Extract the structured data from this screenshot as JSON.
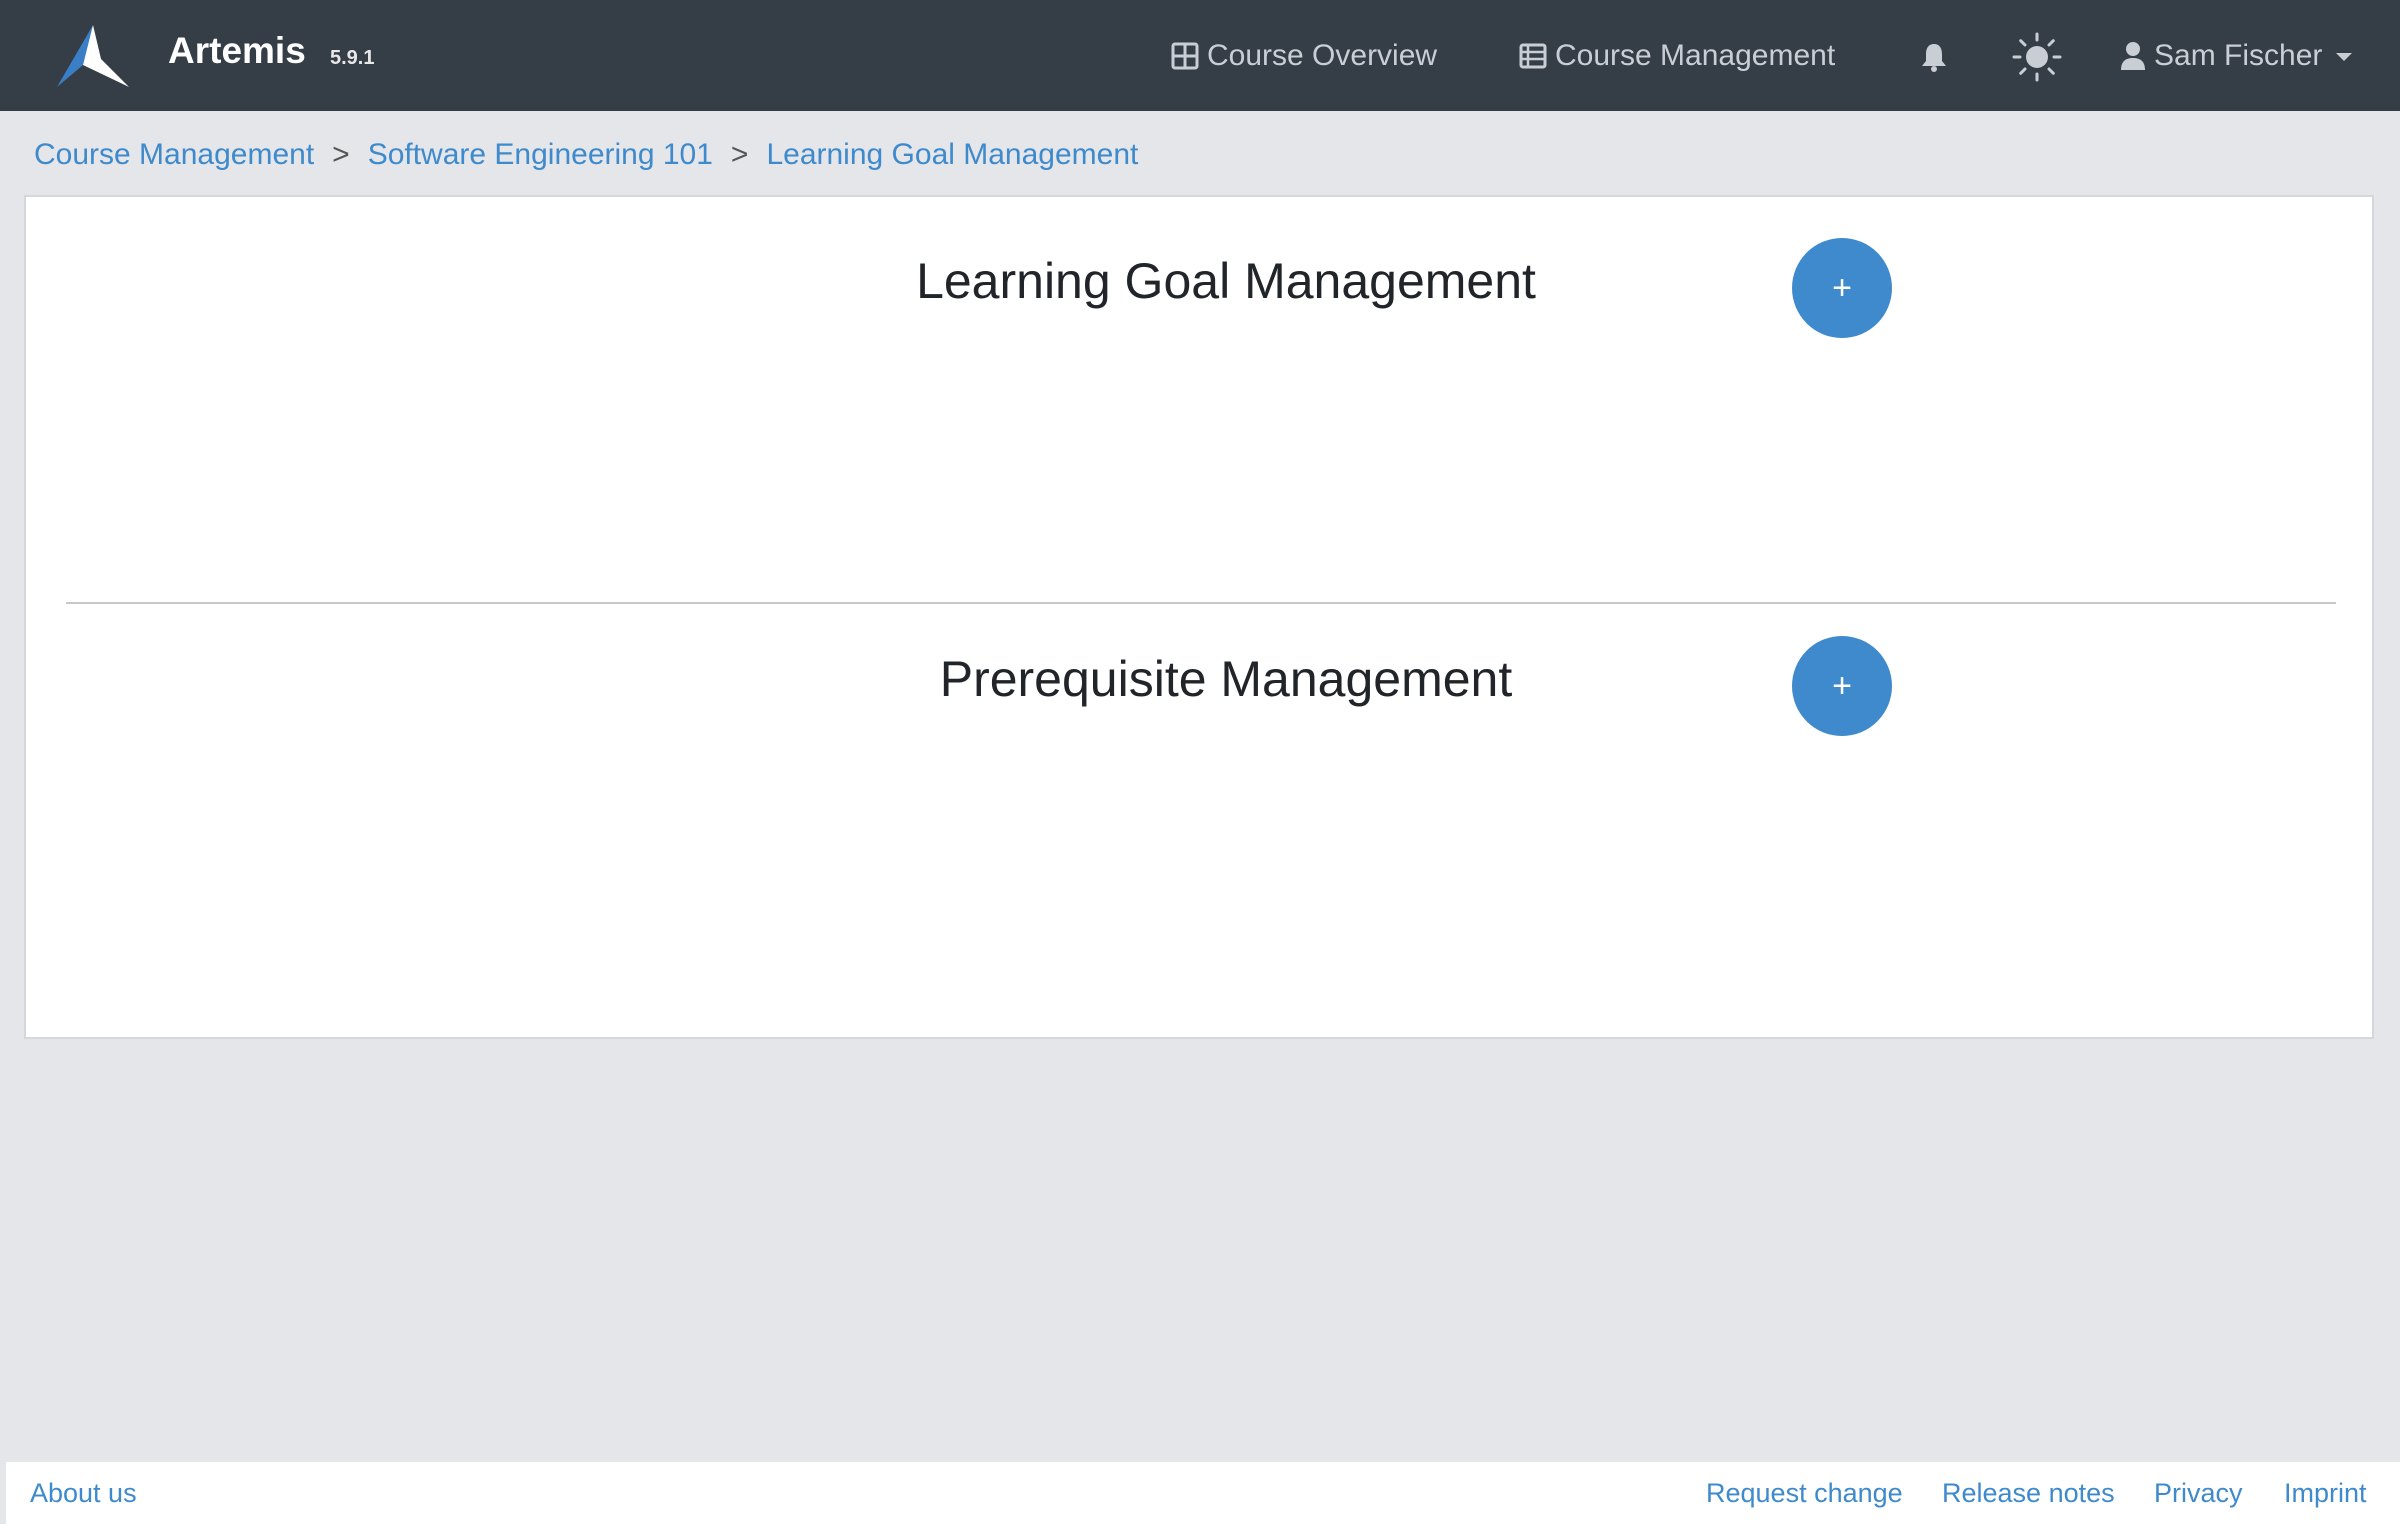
{
  "navbar": {
    "brand": "Artemis",
    "version": "5.9.1",
    "links": [
      {
        "label": "Course Overview",
        "icon": "grid-icon"
      },
      {
        "label": "Course Management",
        "icon": "table-icon"
      }
    ],
    "notification_icon": "bell-icon",
    "theme_icon": "sun-icon",
    "user": {
      "name": "Sam Fischer",
      "icon": "user-icon"
    }
  },
  "breadcrumb": {
    "items": [
      "Course Management",
      "Software Engineering 101",
      "Learning Goal Management"
    ],
    "separator": ">"
  },
  "main": {
    "sections": [
      {
        "title": "Learning Goal Management",
        "add_label": "+"
      },
      {
        "title": "Prerequisite Management",
        "add_label": "+"
      }
    ]
  },
  "footer": {
    "left": [
      "About us"
    ],
    "right": [
      "Request change",
      "Release notes",
      "Privacy",
      "Imprint"
    ]
  },
  "colors": {
    "navbar_bg": "#353d47",
    "accent": "#3e8acc",
    "page_bg": "#e4e6e9"
  }
}
